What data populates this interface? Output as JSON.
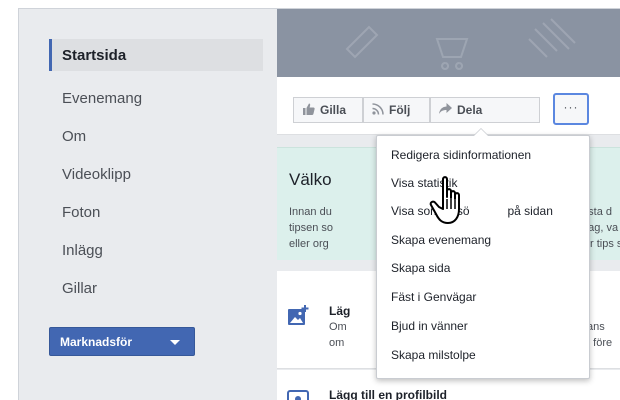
{
  "sidebar": {
    "items": [
      {
        "label": "Startsida",
        "active": true
      },
      {
        "label": "Evenemang"
      },
      {
        "label": "Om"
      },
      {
        "label": "Videoklipp"
      },
      {
        "label": "Foton"
      },
      {
        "label": "Inlägg"
      },
      {
        "label": "Gillar"
      }
    ],
    "promote_label": "Marknadsför"
  },
  "actions": {
    "like": "Gilla",
    "follow": "Följ",
    "share": "Dela",
    "more": "···"
  },
  "welcome": {
    "title": "Välko",
    "line1_left": "Innan du",
    "line1_right": "testa d",
    "line2_left": "tipsen so",
    "line2_right": "etag, va",
    "line3_left": "eller org",
    "line3_right": "ller tips s"
  },
  "tasks": [
    {
      "title": "Läg",
      "desc1": "Om",
      "desc1_right": "sidans",
      "desc2": "om",
      "desc2_right": "ytt i före"
    },
    {
      "title": "Lägg till en profilbild"
    }
  ],
  "dropdown": {
    "items": [
      "Redigera sidinformationen",
      "Visa statistik",
      "Visa som besö",
      "Skapa evenemang",
      "Skapa sida",
      "Fäst i Genvägar",
      "Bjud in vänner",
      "Skapa milstolpe"
    ],
    "item3_suffix": "på sidan"
  },
  "colors": {
    "accent": "#4267b2",
    "sidebar_bg": "#e9ebee",
    "welcome_bg": "#dcf0ec",
    "focus_border": "#5b87e0"
  },
  "icons": {
    "like": "thumbs-up-icon",
    "follow": "rss-icon",
    "share": "share-arrow-icon",
    "task": "add-photo-icon",
    "cursor": "hand-pointer-icon"
  }
}
